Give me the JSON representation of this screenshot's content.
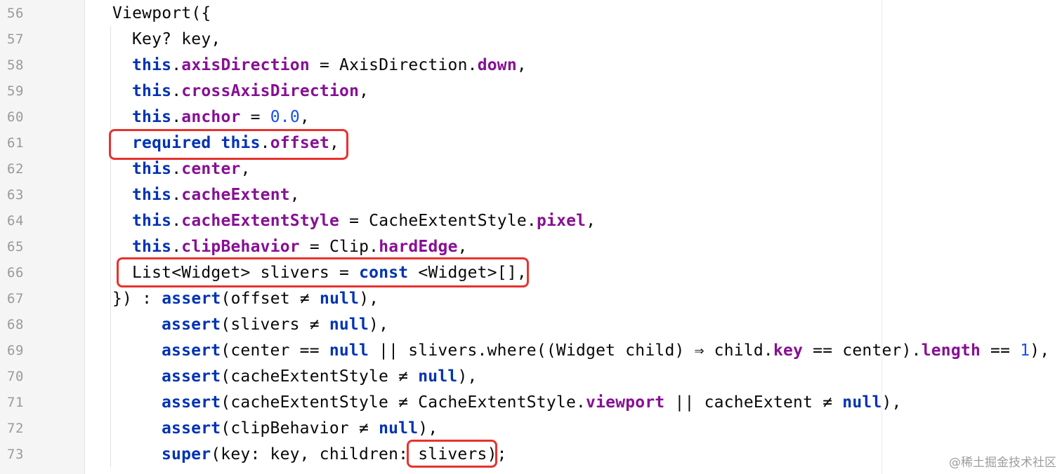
{
  "editor": {
    "line_numbers": [
      "56",
      "57",
      "58",
      "59",
      "60",
      "61",
      "62",
      "63",
      "64",
      "65",
      "66",
      "67",
      "68",
      "69",
      "70",
      "71",
      "72",
      "73"
    ],
    "lines": [
      [
        {
          "t": "Viewport({",
          "c": "plain"
        }
      ],
      [
        {
          "t": "Key? key,",
          "c": "plain"
        }
      ],
      [
        {
          "t": "this",
          "c": "kw"
        },
        {
          "t": ".",
          "c": "plain"
        },
        {
          "t": "axisDirection",
          "c": "field"
        },
        {
          "t": " = AxisDirection.",
          "c": "plain"
        },
        {
          "t": "down",
          "c": "field"
        },
        {
          "t": ",",
          "c": "plain"
        }
      ],
      [
        {
          "t": "this",
          "c": "kw"
        },
        {
          "t": ".",
          "c": "plain"
        },
        {
          "t": "crossAxisDirection",
          "c": "field"
        },
        {
          "t": ",",
          "c": "plain"
        }
      ],
      [
        {
          "t": "this",
          "c": "kw"
        },
        {
          "t": ".",
          "c": "plain"
        },
        {
          "t": "anchor",
          "c": "field"
        },
        {
          "t": " = ",
          "c": "plain"
        },
        {
          "t": "0.0",
          "c": "num"
        },
        {
          "t": ",",
          "c": "plain"
        }
      ],
      [
        {
          "t": "required ",
          "c": "kw"
        },
        {
          "t": "this",
          "c": "kw"
        },
        {
          "t": ".",
          "c": "plain"
        },
        {
          "t": "offset",
          "c": "field"
        },
        {
          "t": ",",
          "c": "plain"
        }
      ],
      [
        {
          "t": "this",
          "c": "kw"
        },
        {
          "t": ".",
          "c": "plain"
        },
        {
          "t": "center",
          "c": "field"
        },
        {
          "t": ",",
          "c": "plain"
        }
      ],
      [
        {
          "t": "this",
          "c": "kw"
        },
        {
          "t": ".",
          "c": "plain"
        },
        {
          "t": "cacheExtent",
          "c": "field"
        },
        {
          "t": ",",
          "c": "plain"
        }
      ],
      [
        {
          "t": "this",
          "c": "kw"
        },
        {
          "t": ".",
          "c": "plain"
        },
        {
          "t": "cacheExtentStyle",
          "c": "field"
        },
        {
          "t": " = CacheExtentStyle.",
          "c": "plain"
        },
        {
          "t": "pixel",
          "c": "field"
        },
        {
          "t": ",",
          "c": "plain"
        }
      ],
      [
        {
          "t": "this",
          "c": "kw"
        },
        {
          "t": ".",
          "c": "plain"
        },
        {
          "t": "clipBehavior",
          "c": "field"
        },
        {
          "t": " = Clip.",
          "c": "plain"
        },
        {
          "t": "hardEdge",
          "c": "field"
        },
        {
          "t": ",",
          "c": "plain"
        }
      ],
      [
        {
          "t": "List<Widget> slivers = ",
          "c": "plain"
        },
        {
          "t": "const",
          "c": "kw"
        },
        {
          "t": " <Widget>[],",
          "c": "plain"
        }
      ],
      [
        {
          "t": "}) : ",
          "c": "plain"
        },
        {
          "t": "assert",
          "c": "kw"
        },
        {
          "t": "(offset ≠ ",
          "c": "plain"
        },
        {
          "t": "null",
          "c": "kw"
        },
        {
          "t": "),",
          "c": "plain"
        }
      ],
      [
        {
          "t": "assert",
          "c": "kw"
        },
        {
          "t": "(slivers ≠ ",
          "c": "plain"
        },
        {
          "t": "null",
          "c": "kw"
        },
        {
          "t": "),",
          "c": "plain"
        }
      ],
      [
        {
          "t": "assert",
          "c": "kw"
        },
        {
          "t": "(center == ",
          "c": "plain"
        },
        {
          "t": "null",
          "c": "kw"
        },
        {
          "t": " || slivers.where((Widget child) ⇒ child.",
          "c": "plain"
        },
        {
          "t": "key",
          "c": "field"
        },
        {
          "t": " == center).",
          "c": "plain"
        },
        {
          "t": "length",
          "c": "field"
        },
        {
          "t": " == ",
          "c": "plain"
        },
        {
          "t": "1",
          "c": "num"
        },
        {
          "t": "),",
          "c": "plain"
        }
      ],
      [
        {
          "t": "assert",
          "c": "kw"
        },
        {
          "t": "(cacheExtentStyle ≠ ",
          "c": "plain"
        },
        {
          "t": "null",
          "c": "kw"
        },
        {
          "t": "),",
          "c": "plain"
        }
      ],
      [
        {
          "t": "assert",
          "c": "kw"
        },
        {
          "t": "(cacheExtentStyle ≠ CacheExtentStyle.",
          "c": "plain"
        },
        {
          "t": "viewport",
          "c": "field"
        },
        {
          "t": " || cacheExtent ≠ ",
          "c": "plain"
        },
        {
          "t": "null",
          "c": "kw"
        },
        {
          "t": "),",
          "c": "plain"
        }
      ],
      [
        {
          "t": "assert",
          "c": "kw"
        },
        {
          "t": "(clipBehavior ≠ ",
          "c": "plain"
        },
        {
          "t": "null",
          "c": "kw"
        },
        {
          "t": "),",
          "c": "plain"
        }
      ],
      [
        {
          "t": "super",
          "c": "kw"
        },
        {
          "t": "(key: key, children: slivers);",
          "c": "plain"
        }
      ]
    ]
  },
  "colors": {
    "keyword": "#0033b3",
    "field": "#871094",
    "number": "#1750eb",
    "highlight_box": "#e8322d"
  },
  "watermark": "@稀土掘金技术社区"
}
